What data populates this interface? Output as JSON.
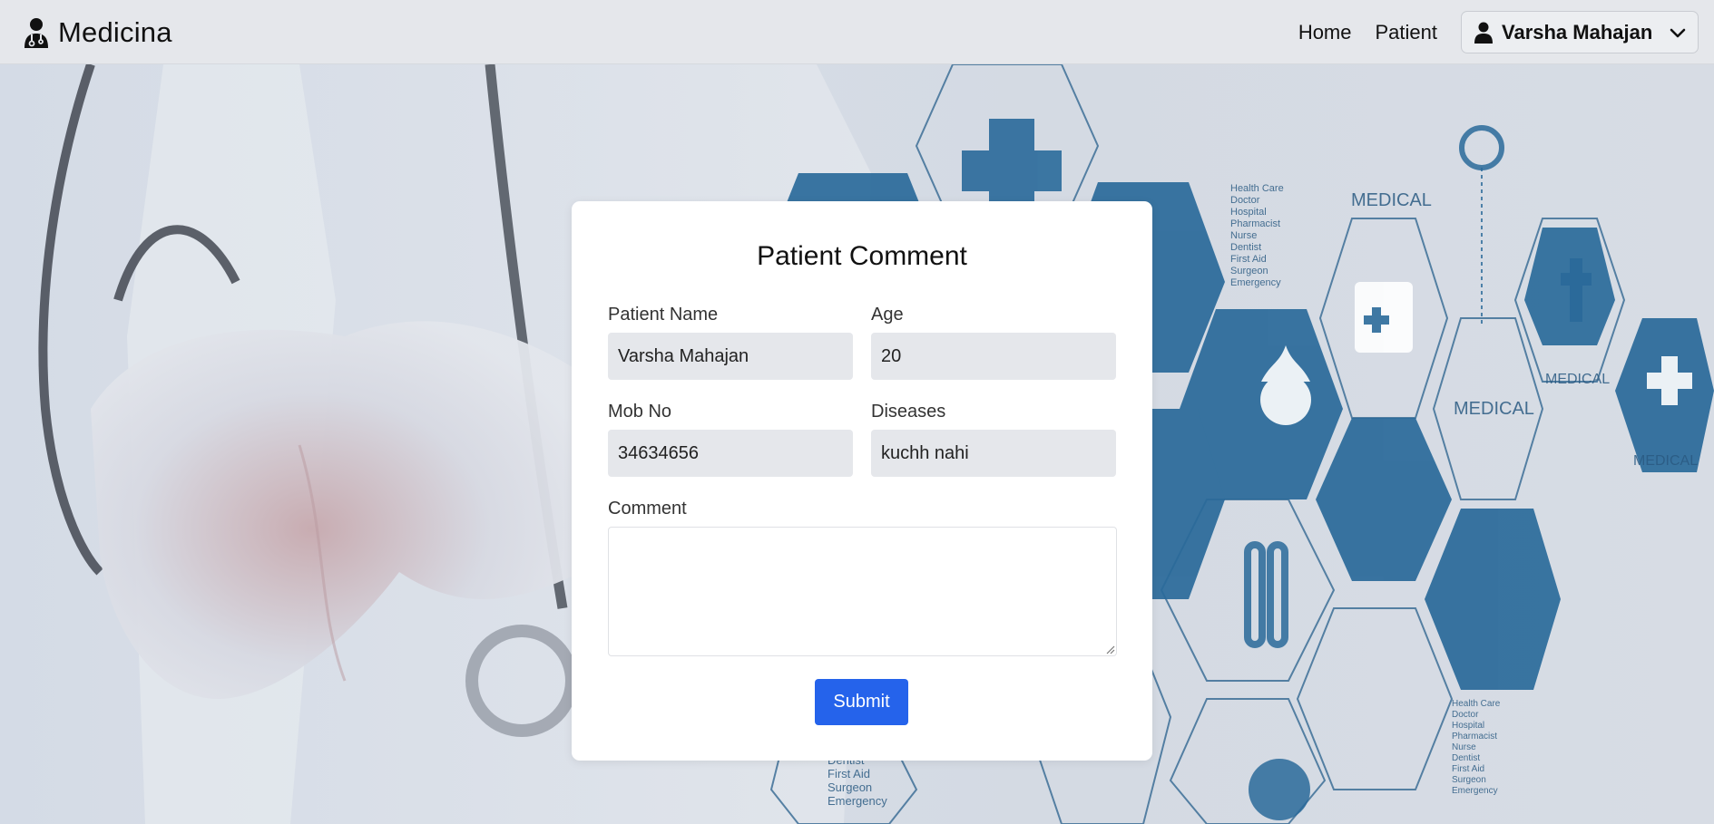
{
  "navbar": {
    "brand": "Medicina",
    "links": [
      "Home",
      "Patient"
    ],
    "user_name": "Varsha Mahajan",
    "icons": {
      "brand": "doctor-icon",
      "user": "user-icon",
      "dropdown": "chevron-down-icon"
    }
  },
  "background": {
    "hex_labels": {
      "medical": "MEDICAL",
      "care_list": [
        "Health Care",
        "Doctor",
        "Hospital",
        "Pharmacist",
        "Nurse",
        "Dentist",
        "First Aid",
        "Surgeon",
        "Emergency"
      ],
      "bottom_list": [
        "Dentist",
        "First Aid",
        "Surgeon",
        "Emergency"
      ]
    },
    "colors": {
      "hex_fill": "#2a6a9a",
      "hex_line": "#3b6f96"
    }
  },
  "form": {
    "title": "Patient Comment",
    "patient_name": {
      "label": "Patient Name",
      "value": "Varsha Mahajan"
    },
    "age": {
      "label": "Age",
      "value": "20"
    },
    "mob_no": {
      "label": "Mob No",
      "value": "34634656"
    },
    "diseases": {
      "label": "Diseases",
      "value": "kuchh nahi"
    },
    "comment": {
      "label": "Comment",
      "value": ""
    },
    "submit_label": "Submit",
    "colors": {
      "submit_bg": "#2563eb",
      "input_bg": "#e5e7eb"
    }
  }
}
